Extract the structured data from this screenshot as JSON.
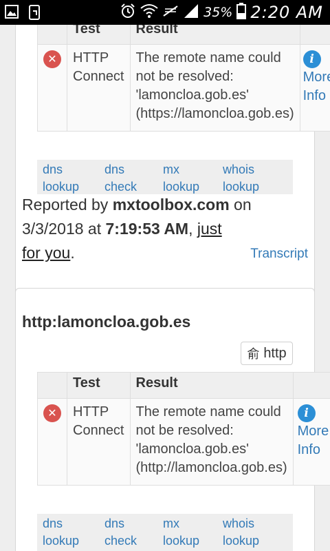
{
  "status_bar": {
    "battery": "35%",
    "time": "2:20 AM"
  },
  "result_table_1": {
    "headers": [
      "Test",
      "Result"
    ],
    "row": {
      "test": [
        "HTTP",
        "Connect"
      ],
      "result": [
        "The remote name could",
        "not be resolved:",
        "'lamoncloa.gob.es'",
        "(https://lamoncloa.gob.es)"
      ],
      "more": [
        "More",
        "Info"
      ]
    }
  },
  "lookup_bar_1": {
    "items": [
      [
        "dns",
        "lookup"
      ],
      [
        "dns",
        "check"
      ],
      [
        "mx",
        "lookup"
      ],
      [
        "whois",
        "lookup"
      ]
    ]
  },
  "report": {
    "prefix": "Reported by ",
    "site": "mxtoolbox.com",
    "on": " on",
    "date": "3/3/2018 at ",
    "time": "7:19:53 AM",
    "comma": ", ",
    "just": "just",
    "for_you": "for you",
    "period": ".",
    "transcript": "Transcript"
  },
  "card2": {
    "title": "http:lamoncloa.gob.es",
    "button_label": "http"
  },
  "result_table_2": {
    "headers": [
      "Test",
      "Result"
    ],
    "row": {
      "test": [
        "HTTP",
        "Connect"
      ],
      "result": [
        "The remote name could",
        "not be resolved:",
        "'lamoncloa.gob.es'",
        "(http://lamoncloa.gob.es)"
      ],
      "more": [
        "More",
        "Info"
      ]
    }
  },
  "lookup_bar_2": {
    "items": [
      [
        "dns",
        "lookup"
      ],
      [
        "dns",
        "check"
      ],
      [
        "mx",
        "lookup"
      ],
      [
        "whois",
        "lookup"
      ]
    ]
  },
  "colors": {
    "link": "#337ab7",
    "error": "#d9534f",
    "info": "#2c8fd6"
  },
  "icons": [
    "gallery-icon",
    "screenshot-icon",
    "alarm-icon",
    "wifi-icon",
    "no-signal-icon",
    "signal-icon",
    "battery-icon",
    "error-icon",
    "info-icon",
    "translate-icon"
  ]
}
